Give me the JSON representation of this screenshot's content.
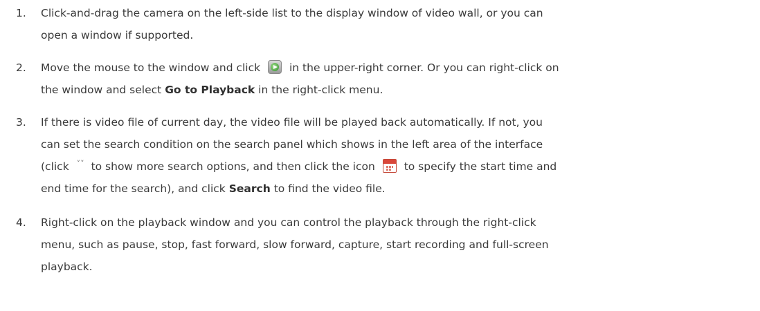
{
  "steps": [
    {
      "number": "1.",
      "line1": "Click-and-drag the camera on the left-side list to the display window of video wall, or you can",
      "line2": "open a window if supported."
    },
    {
      "number": "2.",
      "line1_before_icon": "Move the mouse to the window and click",
      "icon": "playback-icon",
      "line1_after_icon": "in the upper-right corner. Or you can right-click on",
      "line2_before_bold": "the window and select",
      "line2_bold": "Go to Playback",
      "line2_after_bold": "in the right-click menu."
    },
    {
      "number": "3.",
      "line1": "If there is video file of current day, the video file will be played back automatically. If not, you",
      "line2": "can set the search condition on the search panel which shows in the left area of the interface",
      "line3_part1": "(click",
      "line3_icon1": "expand-more-icon",
      "line3_part2": "to show more search options, and then click the icon",
      "line3_icon2": "calendar-icon",
      "line3_part3": "to specify the start time and",
      "line4_part1": "end time for the search), and click",
      "line4_bold": "Search",
      "line4_part2": "to find the video file."
    },
    {
      "number": "4.",
      "line1": "Right-click on the playback window and you can control the playback through the right-click",
      "line2": "menu, such as pause, stop, fast forward, slow forward, capture, start recording and full-screen",
      "line3": "playback."
    }
  ],
  "icons": {
    "expand_more_glyph": "˅˅"
  }
}
